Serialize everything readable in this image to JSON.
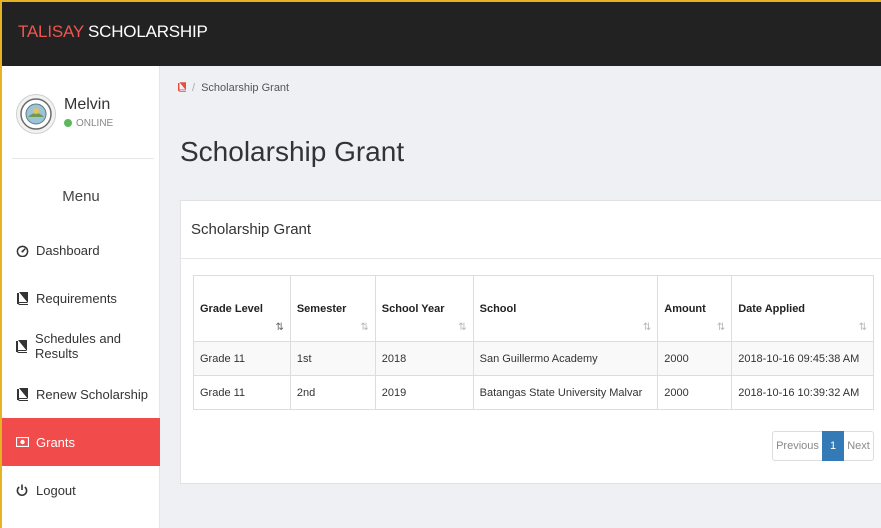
{
  "brand": {
    "part1": "TALISAY",
    "part2": "SCHOLARSHIP"
  },
  "user": {
    "name": "Melvin",
    "status": "ONLINE"
  },
  "menu": {
    "heading": "Menu",
    "items": [
      {
        "label": "Dashboard",
        "icon": "dashboard-icon"
      },
      {
        "label": "Requirements",
        "icon": "book-icon"
      },
      {
        "label": "Schedules and Results",
        "icon": "book-icon"
      },
      {
        "label": "Renew Scholarship",
        "icon": "book-icon"
      },
      {
        "label": "Grants",
        "icon": "money-icon",
        "active": true
      },
      {
        "label": "Logout",
        "icon": "power-icon"
      }
    ]
  },
  "breadcrumb": {
    "current": "Scholarship Grant"
  },
  "page": {
    "title": "Scholarship Grant"
  },
  "card": {
    "title": "Scholarship Grant"
  },
  "table": {
    "columns": [
      "Grade Level",
      "Semester",
      "School Year",
      "School",
      "Amount",
      "Date Applied"
    ],
    "rows": [
      [
        "Grade 11",
        "1st",
        "2018",
        "San Guillermo Academy",
        "2000",
        "2018-10-16 09:45:38 AM"
      ],
      [
        "Grade 11",
        "2nd",
        "2019",
        "Batangas State University Malvar",
        "2000",
        "2018-10-16 10:39:32 AM"
      ]
    ]
  },
  "pagination": {
    "previous": "Previous",
    "page": "1",
    "next": "Next"
  },
  "colors": {
    "topbar": "#222222",
    "brand_accent": "#f0544f",
    "active_menu": "#f24b4b",
    "online": "#5cb85c",
    "pager_active": "#337ab7"
  }
}
